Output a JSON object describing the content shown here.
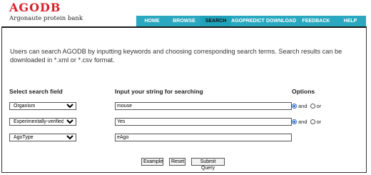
{
  "logo": {
    "title": "AGODB",
    "subtitle": "Argonaute protein bank"
  },
  "nav": [
    {
      "label": "HOME"
    },
    {
      "label": "BROWSE"
    },
    {
      "label": "SEARCH"
    },
    {
      "label": "AGOPREDICT"
    },
    {
      "label": "DOWNLOAD"
    },
    {
      "label": "FEEDBACK"
    },
    {
      "label": "HELP"
    }
  ],
  "active_nav": "SEARCH",
  "colors": {
    "nav_bg": "#2aa8c0",
    "logo_red": "#d8202a"
  },
  "description": "Users can search AGODB by inputting keywords and choosing corresponding search terms. Search results can be downloaded in *.xml or *.csv format.",
  "headers": {
    "field": "Select search field",
    "input": "Input your string for searching",
    "options": "Options"
  },
  "rows": [
    {
      "field": "Organism",
      "value": "mouse",
      "option_and": "and",
      "option_or": "or",
      "selected": "and"
    },
    {
      "field": "Experimentally-verified",
      "value": "Yes",
      "option_and": "and",
      "option_or": "or",
      "selected": "and"
    },
    {
      "field": "AgoType",
      "value": "eAgo"
    }
  ],
  "buttons": {
    "example": "Example",
    "reset": "Reset",
    "submit": "Submit Query"
  }
}
